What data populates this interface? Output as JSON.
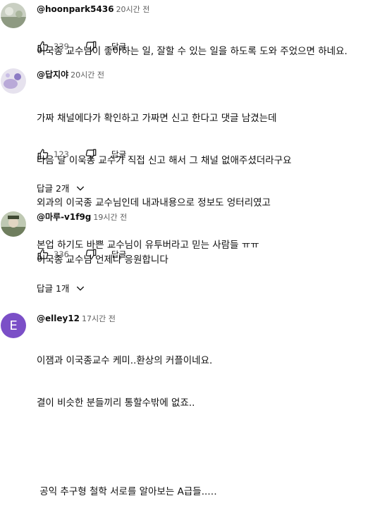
{
  "comments": [
    {
      "author": "@hoonpark5436",
      "time": "20시간 전",
      "lines": [
        "이국종 교수님이 좋아하는 일, 잘할 수 있는 일을 하도록 도와 주었으면 하네요."
      ],
      "likes": "339",
      "reply_label": "답글"
    },
    {
      "author": "@답지야",
      "time": "20시간 전",
      "lines": [
        "가짜 채널에다가 확인하고 가짜면 신고 한다고 댓글 남겼는데",
        "다음 날 이욱종 교수가 직접 신고 해서 그 채널 없애주셨더라구요",
        "외과의 이국종 교수님인데 내과내용으로 정보도 엉터리였고",
        "본업 하기도 바쁜 교수님이 유투버라고 믿는 사람들 ㅠㅠ"
      ],
      "likes": "123",
      "reply_label": "답글",
      "replies_toggle": "답글 2개"
    },
    {
      "author": "@마루-v1f9g",
      "time": "19시간 전",
      "lines": [
        "이국종 교수님 언제나 응원합니다"
      ],
      "likes": "336",
      "reply_label": "답글",
      "replies_toggle": "답글 1개"
    },
    {
      "author": "@elley12",
      "time": "17시간 전",
      "avatar_letter": "E",
      "avatar_color": "#7b4fc7",
      "lines": [
        "이잼과 이국종교수 케미..환상의 커플이네요.",
        "결이 비슷한 분들끼리 통할수밖에 없죠..",
        "",
        " 공익 추구형 철학 서로를 알아보는 A급들..…"
      ]
    }
  ]
}
